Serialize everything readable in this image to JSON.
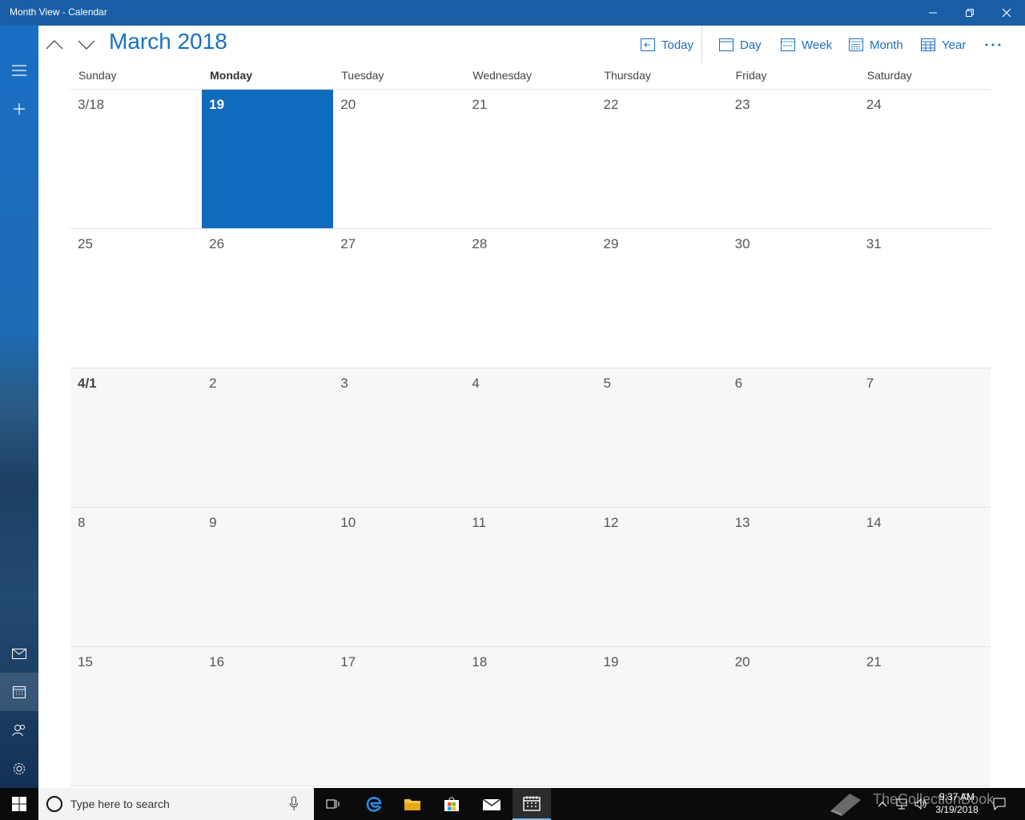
{
  "window": {
    "title": "Month View - Calendar"
  },
  "header": {
    "month_title": "March 2018",
    "today_label": "Today",
    "day_label": "Day",
    "week_label": "Week",
    "month_label": "Month",
    "year_label": "Year"
  },
  "weekdays": [
    "Sunday",
    "Monday",
    "Tuesday",
    "Wednesday",
    "Thursday",
    "Friday",
    "Saturday"
  ],
  "weeks": [
    [
      "3/18",
      "19",
      "20",
      "21",
      "22",
      "23",
      "24"
    ],
    [
      "25",
      "26",
      "27",
      "28",
      "29",
      "30",
      "31"
    ],
    [
      "4/1",
      "2",
      "3",
      "4",
      "5",
      "6",
      "7"
    ],
    [
      "8",
      "9",
      "10",
      "11",
      "12",
      "13",
      "14"
    ],
    [
      "15",
      "16",
      "17",
      "18",
      "19",
      "20",
      "21"
    ]
  ],
  "taskbar": {
    "search_placeholder": "Type here to search",
    "time": "9:37 AM",
    "date": "3/19/2018",
    "watermark": "TheCollectionBook"
  },
  "colors": {
    "accent": "#1a6fc4",
    "titlebar": "#1a5ea5",
    "today_cell": "#0f6cbd"
  }
}
